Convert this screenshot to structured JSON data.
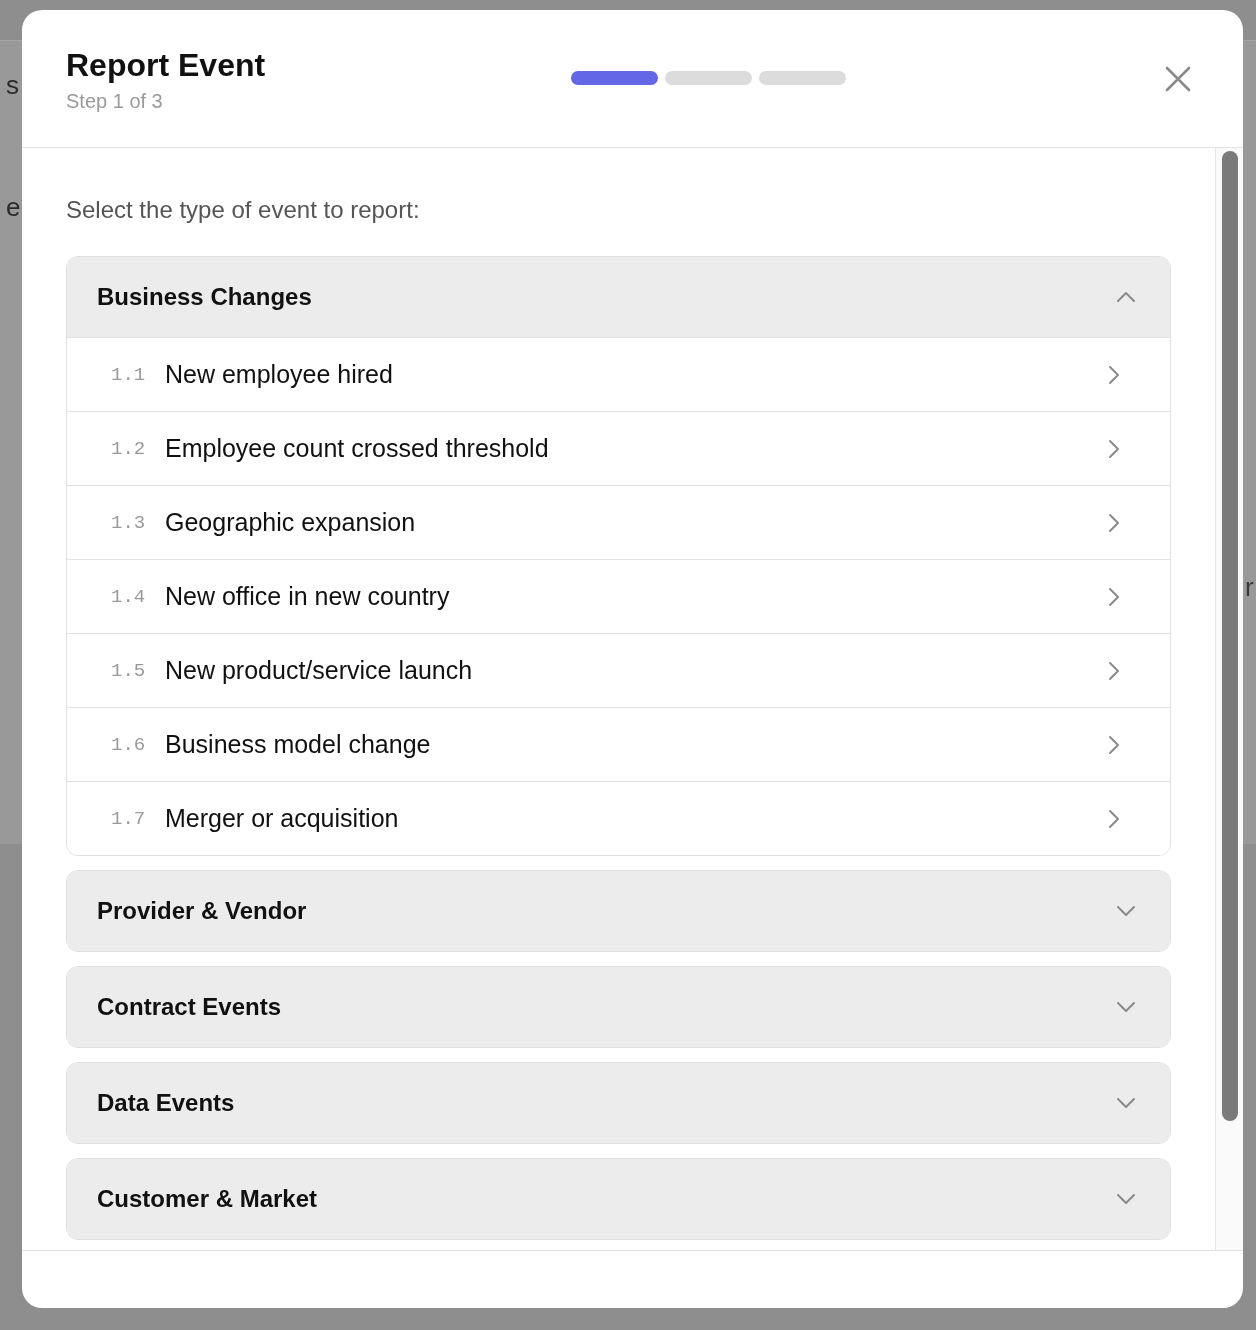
{
  "background_left_texts": [
    "s",
    "e"
  ],
  "background_right_texts": [
    "r"
  ],
  "modal": {
    "title": "Report Event",
    "step": "Step 1 of 3",
    "progress": [
      {
        "active": true
      },
      {
        "active": false
      },
      {
        "active": false
      }
    ],
    "prompt": "Select the type of event to report:",
    "sections": [
      {
        "title": "Business Changes",
        "expanded": true,
        "items": [
          {
            "number": "1.1",
            "label": "New employee hired"
          },
          {
            "number": "1.2",
            "label": "Employee count crossed threshold"
          },
          {
            "number": "1.3",
            "label": "Geographic expansion"
          },
          {
            "number": "1.4",
            "label": "New office in new country"
          },
          {
            "number": "1.5",
            "label": "New product/service launch"
          },
          {
            "number": "1.6",
            "label": "Business model change"
          },
          {
            "number": "1.7",
            "label": "Merger or acquisition"
          }
        ]
      },
      {
        "title": "Provider & Vendor",
        "expanded": false
      },
      {
        "title": "Contract Events",
        "expanded": false
      },
      {
        "title": "Data Events",
        "expanded": false
      },
      {
        "title": "Customer & Market",
        "expanded": false
      }
    ]
  }
}
